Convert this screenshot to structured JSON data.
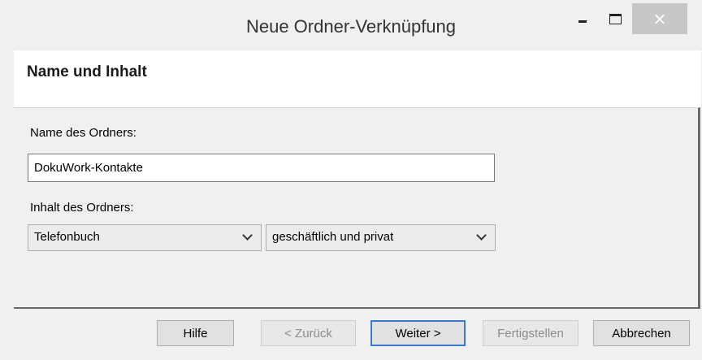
{
  "window": {
    "title": "Neue Ordner-Verknüpfung",
    "close_glyph": "×"
  },
  "header": {
    "heading": "Name und Inhalt"
  },
  "form": {
    "name_label": "Name des Ordners:",
    "name_value": "DokuWork-Kontakte",
    "content_label": "Inhalt des Ordners:",
    "content_type_selected": "Telefonbuch",
    "content_scope_selected": "geschäftlich und privat"
  },
  "buttons": {
    "help": "Hilfe",
    "back": "< Zurück",
    "next": "Weiter >",
    "finish": "Fertigstellen",
    "cancel": "Abbrechen"
  },
  "colors": {
    "background": "#f0f0f0",
    "header_background": "#ffffff",
    "close_button": "#c7c7c7",
    "default_button_border": "#3a7bd5",
    "disabled_text": "#8c8c8c"
  }
}
